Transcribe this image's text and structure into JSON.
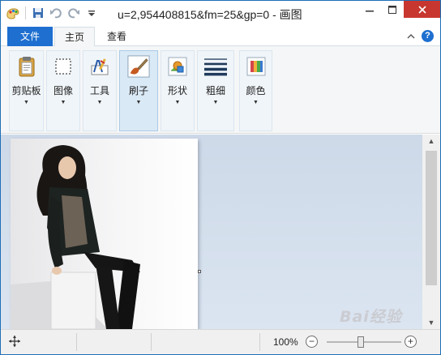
{
  "titlebar": {
    "title": "u=2,954408815&fm=25&gp=0 - 画图",
    "qat_icons": [
      "paint-app-icon",
      "save-icon",
      "undo-icon",
      "redo-icon",
      "customize-qat-icon"
    ],
    "buttons": [
      "minimize",
      "maximize",
      "close"
    ]
  },
  "tabs": {
    "file": "文件",
    "home": "主页",
    "view": "查看"
  },
  "ribbon": {
    "groups": [
      {
        "label": "剪贴板",
        "icon": "clipboard-icon"
      },
      {
        "label": "图像",
        "icon": "select-icon"
      },
      {
        "label": "工具",
        "icon": "tools-icon"
      },
      {
        "label": "刷子",
        "icon": "brush-icon",
        "active": true
      },
      {
        "label": "形状",
        "icon": "shapes-icon"
      },
      {
        "label": "粗细",
        "icon": "line-weight-icon"
      },
      {
        "label": "颜色",
        "icon": "colors-icon"
      }
    ]
  },
  "status": {
    "zoom": "100%"
  },
  "watermark": "Bai经验",
  "colors": {
    "accent": "#1e6fd0",
    "close": "#c7372f",
    "workspace": "#cdd9e8"
  }
}
